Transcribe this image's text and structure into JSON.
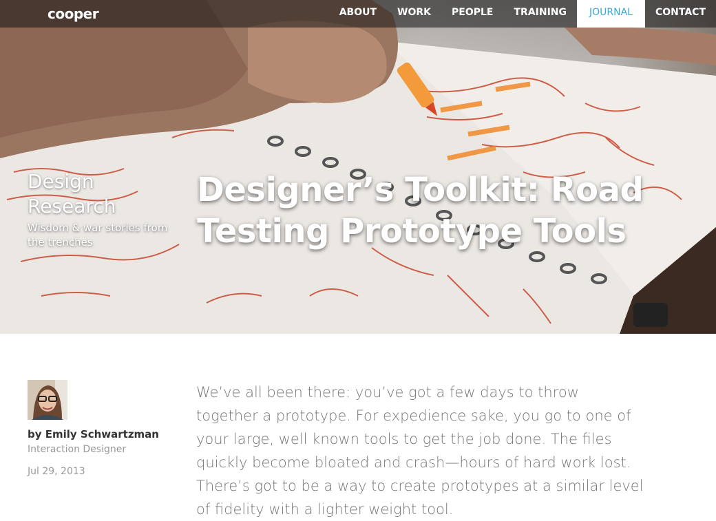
{
  "nav": {
    "logo": "cooper",
    "items": [
      {
        "label": "ABOUT"
      },
      {
        "label": "WORK"
      },
      {
        "label": "PEOPLE"
      },
      {
        "label": "TRAINING"
      },
      {
        "label": "JOURNAL",
        "active": true
      },
      {
        "label": "CONTACT"
      }
    ],
    "active_color": "#3aa8d8"
  },
  "hero": {
    "category_title": "Design Research",
    "category_subtitle": "Wisdom & war stories from the trenches",
    "post_title": "Designer’s Toolkit: Road Testing Prototype Tools"
  },
  "author": {
    "name": "by Emily Schwartzman",
    "role": "Interaction Designer",
    "date": "Jul 29, 2013"
  },
  "article": {
    "intro": "We’ve all been there: you’ve got a few days to throw together a prototype. For expedience sake, you go to one of your large, well known tools to get the job done. The files quickly become bloated and crash—hours of hard work lost. There’s got to be a way to create prototypes at a similar level of fidelity with a lighter weight tool."
  }
}
